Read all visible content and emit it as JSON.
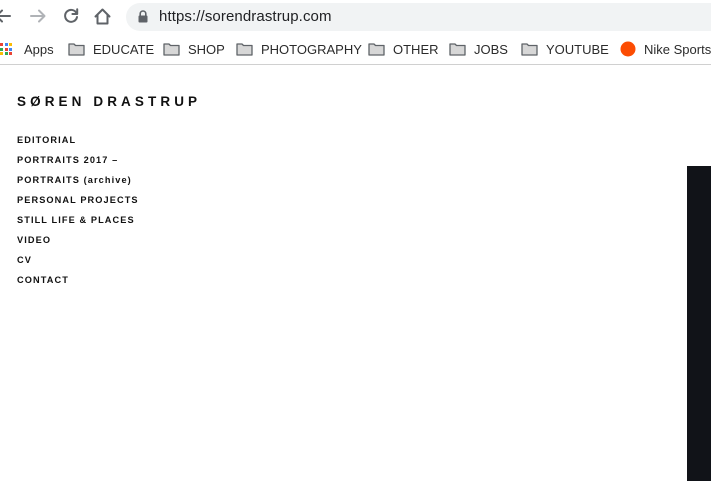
{
  "browser": {
    "url": "https://sorendrastrup.com",
    "bookmarks": [
      {
        "label": "Apps",
        "icon": "apps-grid-icon"
      },
      {
        "label": "EDUCATE",
        "icon": "folder-icon"
      },
      {
        "label": "SHOP",
        "icon": "folder-icon"
      },
      {
        "label": "PHOTOGRAPHY",
        "icon": "folder-icon"
      },
      {
        "label": "OTHER",
        "icon": "folder-icon"
      },
      {
        "label": "JOBS",
        "icon": "folder-icon"
      },
      {
        "label": "YOUTUBE",
        "icon": "folder-icon"
      },
      {
        "label": "Nike Sportsv",
        "icon": "strava-icon"
      }
    ]
  },
  "site": {
    "title": "SØREN DRASTRUP",
    "nav": [
      "EDITORIAL",
      "PORTRAITS 2017 –",
      "PORTRAITS (archive)",
      "PERSONAL PROJECTS",
      "STILL LIFE & PLACES",
      "VIDEO",
      "CV",
      "CONTACT"
    ]
  },
  "colors": {
    "text": "#111111",
    "omnibox_bg": "#f1f3f4",
    "strava_orange": "#fc4c02",
    "folder_gray": "#5f6368",
    "dark_image": "#111318"
  }
}
